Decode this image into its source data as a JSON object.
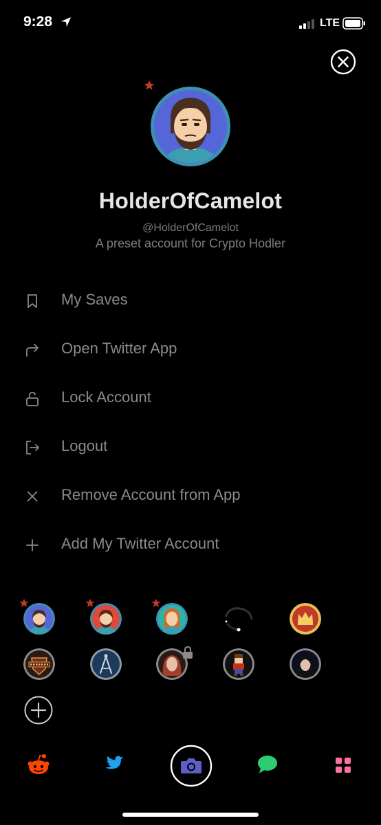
{
  "status_bar": {
    "time": "9:28",
    "network": "LTE"
  },
  "profile": {
    "display_name": "HolderOfCamelot",
    "handle": "@HolderOfCamelot",
    "bio": "A preset account for Crypto Hodler"
  },
  "menu": {
    "items": [
      {
        "label": "My Saves",
        "icon": "bookmark-icon"
      },
      {
        "label": "Open Twitter App",
        "icon": "share-arrow-icon"
      },
      {
        "label": "Lock Account",
        "icon": "unlock-icon"
      },
      {
        "label": "Logout",
        "icon": "logout-icon"
      },
      {
        "label": "Remove Account from App",
        "icon": "close-icon"
      },
      {
        "label": "Add My Twitter Account",
        "icon": "plus-icon"
      }
    ]
  },
  "accounts": {
    "row1": [
      "avatar-bearded-blue",
      "avatar-bearded-red",
      "avatar-redhair-teal",
      "avatar-dark-swirl",
      "avatar-crown-gold"
    ],
    "row2": [
      "avatar-camelot-logo",
      "avatar-compass",
      "avatar-redhead-locked",
      "avatar-pixel-character",
      "avatar-woman-dark"
    ]
  },
  "bottom_nav": {
    "items": [
      "reddit-icon",
      "twitter-icon",
      "camera-icon",
      "chat-icon",
      "apps-grid-icon"
    ]
  },
  "colors": {
    "accent_star": "#c0392b",
    "reddit": "#ff4500",
    "twitter": "#1da1f2",
    "camera": "#5b5fc7",
    "chat": "#2ecc71",
    "apps": "#ff6fa3",
    "menu_text": "#8a8a8a"
  }
}
